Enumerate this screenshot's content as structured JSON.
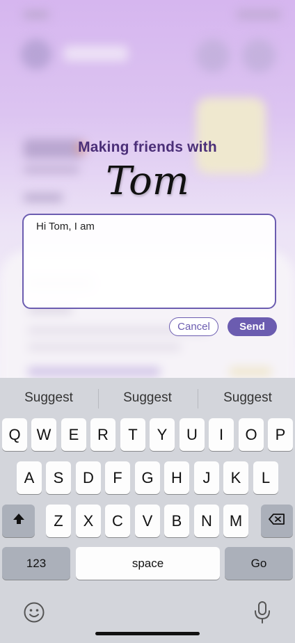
{
  "dialog": {
    "heading": "Making friends with",
    "friend_name": "Tom",
    "message_value": "Hi Tom, I am",
    "cancel_label": "Cancel",
    "send_label": "Send",
    "accent_color": "#6b5cb0"
  },
  "keyboard": {
    "suggestions": [
      "Suggest",
      "Suggest",
      "Suggest"
    ],
    "row1": [
      "Q",
      "W",
      "E",
      "R",
      "T",
      "Y",
      "U",
      "I",
      "O",
      "P"
    ],
    "row2": [
      "A",
      "S",
      "D",
      "F",
      "G",
      "H",
      "J",
      "K",
      "L"
    ],
    "row3": [
      "Z",
      "X",
      "C",
      "V",
      "B",
      "N",
      "M"
    ],
    "shift_icon": "shift-icon",
    "delete_icon": "backspace-icon",
    "numbers_label": "123",
    "space_label": "space",
    "go_label": "Go",
    "emoji_icon": "emoji-icon",
    "mic_icon": "microphone-icon"
  }
}
